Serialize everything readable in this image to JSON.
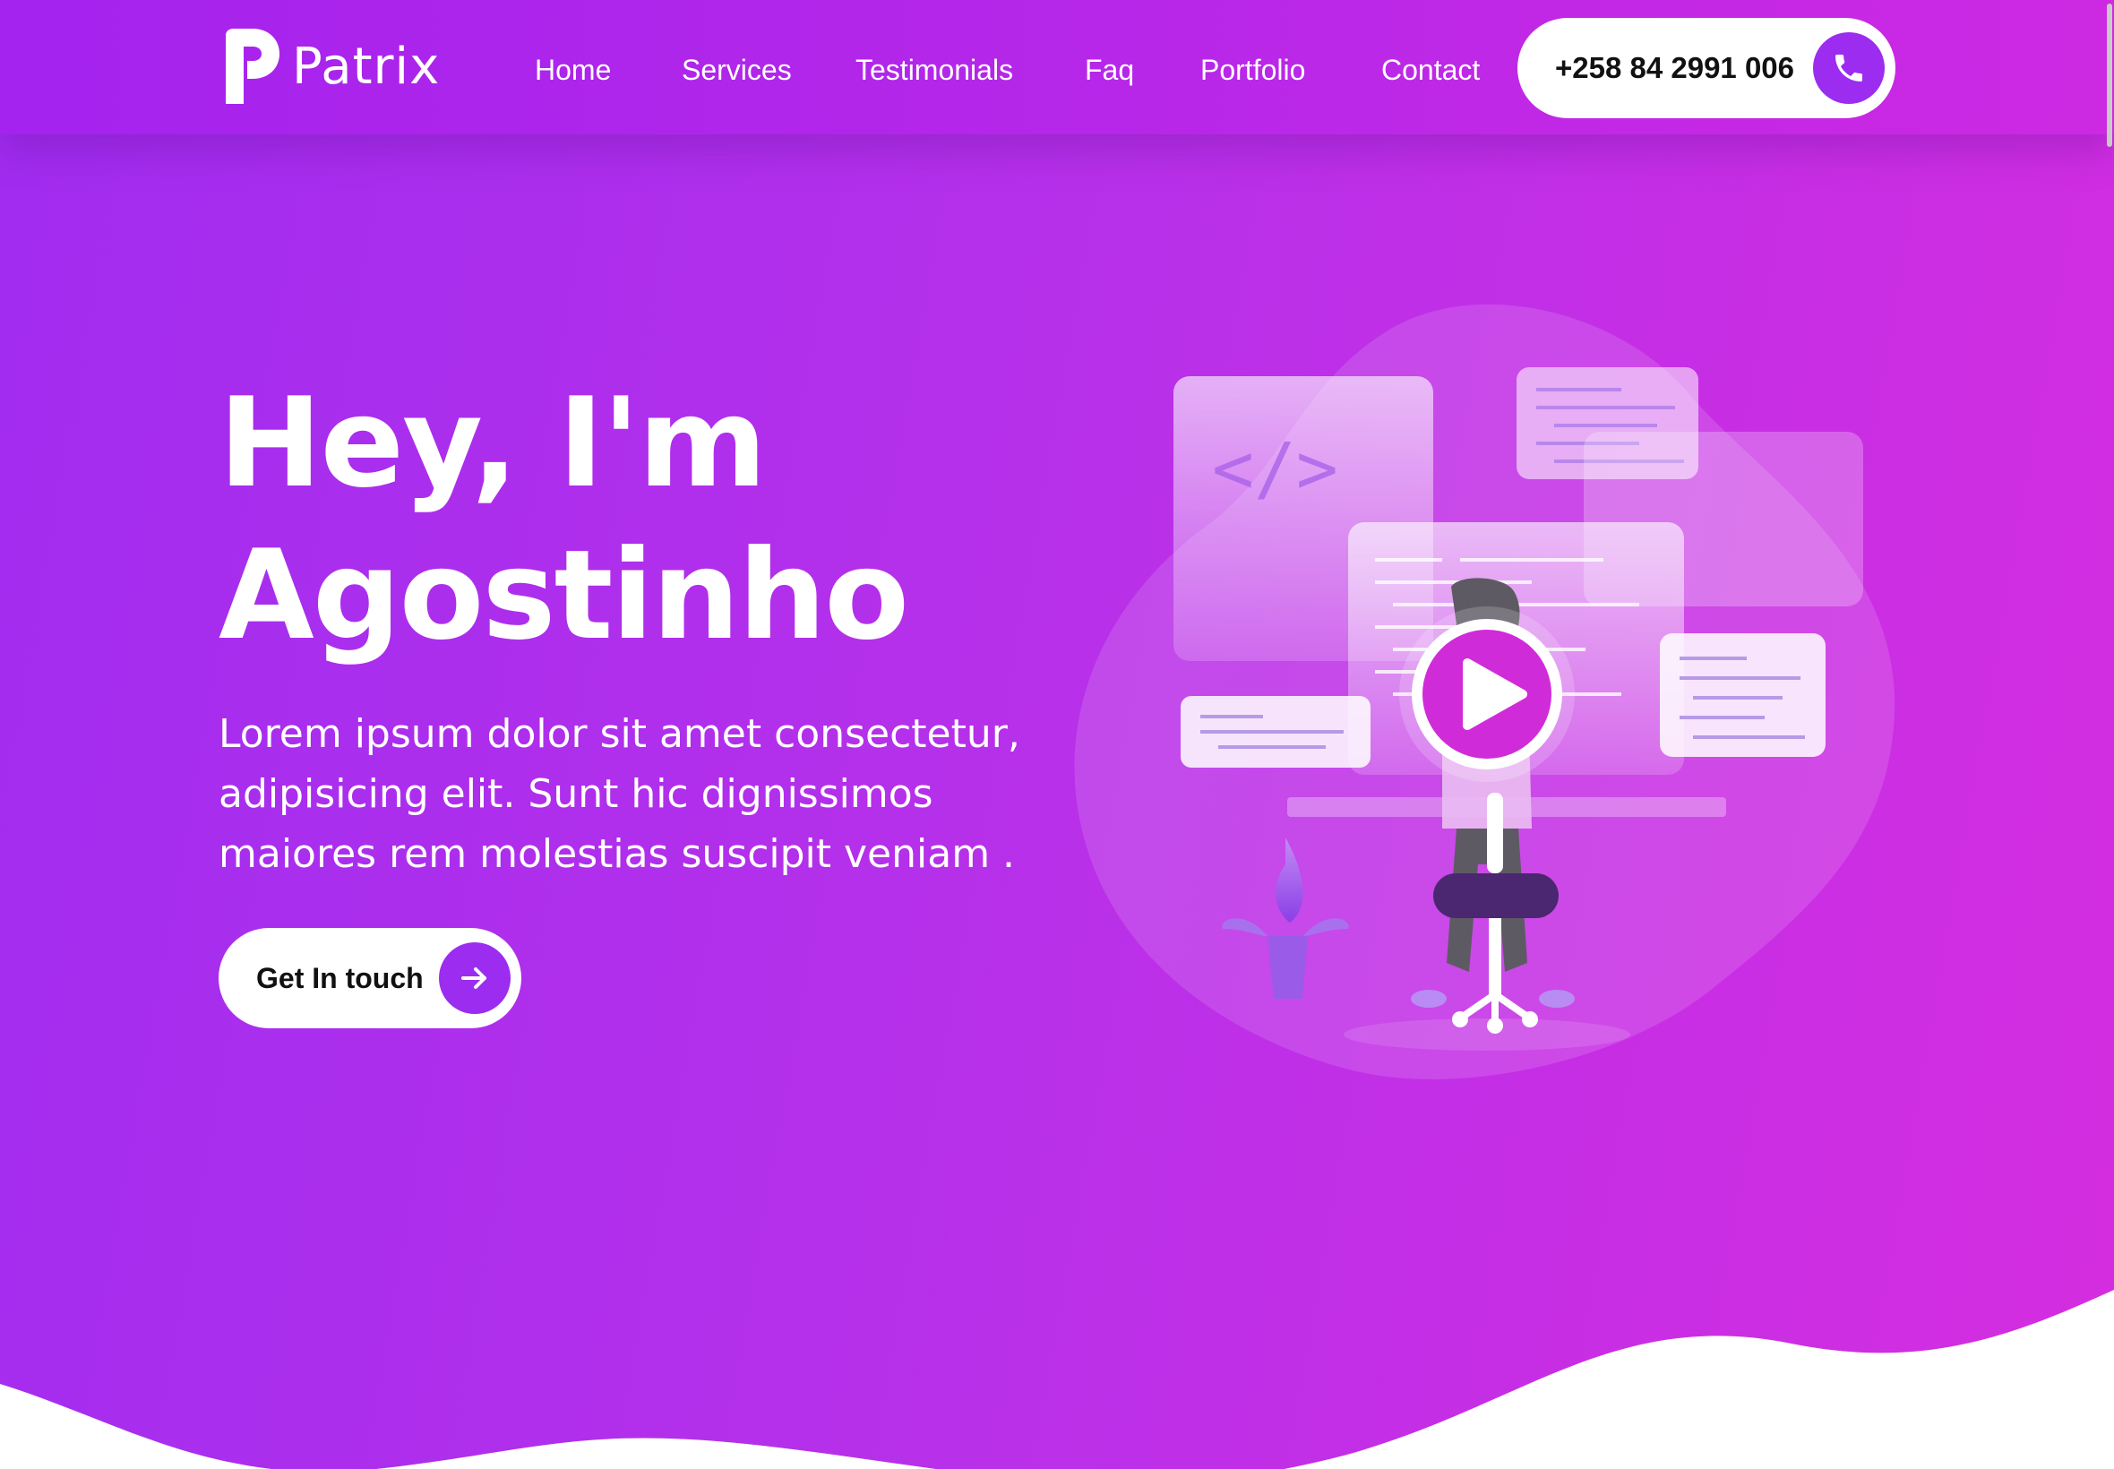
{
  "brand": {
    "name": "Patrix",
    "logo_icon": "patrix-p-logo"
  },
  "nav": {
    "items": [
      {
        "label": "Home"
      },
      {
        "label": "Services"
      },
      {
        "label": "Testimonials"
      },
      {
        "label": "Faq"
      },
      {
        "label": "Portfolio"
      },
      {
        "label": "Contact"
      }
    ]
  },
  "header": {
    "phone": "+258 84 2991 006",
    "phone_icon": "phone-icon"
  },
  "hero": {
    "title_line1": "Hey, I'm",
    "title_line2": "Agostinho",
    "description": "Lorem ipsum dolor sit amet consectetur, adipisicing elit. Sunt hic dignissimos maiores rem molestias suscipit veniam .",
    "cta_label": "Get In touch",
    "cta_icon": "arrow-right-icon",
    "illustration_icon": "developer-at-desk-illustration",
    "play_icon": "play-icon"
  },
  "colors": {
    "accent": "#9b2cf0",
    "gradient_start": "#a12cf0",
    "gradient_end": "#d52de0",
    "play": "#d02bd9"
  }
}
